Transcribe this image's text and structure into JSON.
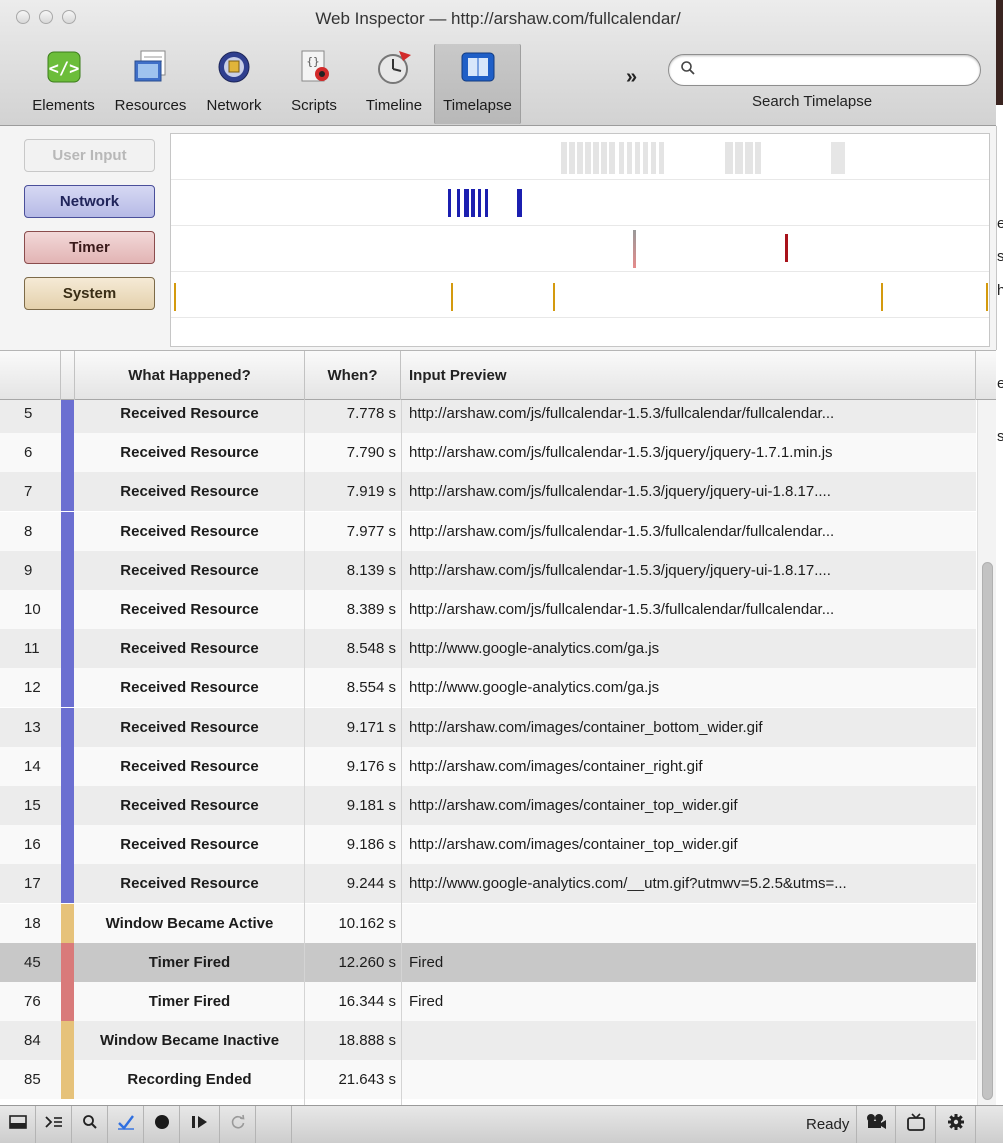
{
  "window": {
    "title": "Web Inspector — http://arshaw.com/fullcalendar/"
  },
  "toolbar": {
    "items": [
      {
        "label": "Elements"
      },
      {
        "label": "Resources"
      },
      {
        "label": "Network"
      },
      {
        "label": "Scripts"
      },
      {
        "label": "Timeline"
      },
      {
        "label": "Timelapse",
        "active": true
      }
    ],
    "overflow_label": "»",
    "search": {
      "value": "",
      "label": "Search Timelapse"
    }
  },
  "overview": {
    "categories": [
      {
        "label": "User Input",
        "enabled": false
      },
      {
        "label": "Network"
      },
      {
        "label": "Timer"
      },
      {
        "label": "System"
      }
    ],
    "colors": {
      "network": "#1b1fb0",
      "timer": "#a8121a",
      "system": "#d49a0e",
      "user": "#e2e2e2"
    }
  },
  "side_chars": [
    "e",
    "s",
    "h",
    "e",
    "s"
  ],
  "table": {
    "columns": [
      "What Happened?",
      "When?",
      "Input Preview"
    ],
    "rows": [
      {
        "num": "5",
        "kind": "network",
        "what": "Received Resource",
        "when": "7.778 s",
        "preview": "http://arshaw.com/js/fullcalendar-1.5.3/fullcalendar/fullcalendar..."
      },
      {
        "num": "6",
        "kind": "network",
        "what": "Received Resource",
        "when": "7.790 s",
        "preview": "http://arshaw.com/js/fullcalendar-1.5.3/jquery/jquery-1.7.1.min.js"
      },
      {
        "num": "7",
        "kind": "network",
        "what": "Received Resource",
        "when": "7.919 s",
        "preview": "http://arshaw.com/js/fullcalendar-1.5.3/jquery/jquery-ui-1.8.17...."
      },
      {
        "num": "8",
        "kind": "network",
        "what": "Received Resource",
        "when": "7.977 s",
        "preview": "http://arshaw.com/js/fullcalendar-1.5.3/fullcalendar/fullcalendar..."
      },
      {
        "num": "9",
        "kind": "network",
        "what": "Received Resource",
        "when": "8.139 s",
        "preview": "http://arshaw.com/js/fullcalendar-1.5.3/jquery/jquery-ui-1.8.17...."
      },
      {
        "num": "10",
        "kind": "network",
        "what": "Received Resource",
        "when": "8.389 s",
        "preview": "http://arshaw.com/js/fullcalendar-1.5.3/fullcalendar/fullcalendar..."
      },
      {
        "num": "11",
        "kind": "network",
        "what": "Received Resource",
        "when": "8.548 s",
        "preview": "http://www.google-analytics.com/ga.js"
      },
      {
        "num": "12",
        "kind": "network",
        "what": "Received Resource",
        "when": "8.554 s",
        "preview": "http://www.google-analytics.com/ga.js"
      },
      {
        "num": "13",
        "kind": "network",
        "what": "Received Resource",
        "when": "9.171 s",
        "preview": "http://arshaw.com/images/container_bottom_wider.gif"
      },
      {
        "num": "14",
        "kind": "network",
        "what": "Received Resource",
        "when": "9.176 s",
        "preview": "http://arshaw.com/images/container_right.gif"
      },
      {
        "num": "15",
        "kind": "network",
        "what": "Received Resource",
        "when": "9.181 s",
        "preview": "http://arshaw.com/images/container_top_wider.gif"
      },
      {
        "num": "16",
        "kind": "network",
        "what": "Received Resource",
        "when": "9.186 s",
        "preview": "http://arshaw.com/images/container_top_wider.gif"
      },
      {
        "num": "17",
        "kind": "network",
        "what": "Received Resource",
        "when": "9.244 s",
        "preview": "http://www.google-analytics.com/__utm.gif?utmwv=5.2.5&utms=..."
      },
      {
        "num": "18",
        "kind": "system",
        "what": "Window Became Active",
        "when": "10.162 s",
        "preview": ""
      },
      {
        "num": "45",
        "kind": "timer",
        "what": "Timer Fired",
        "when": "12.260 s",
        "preview": "Fired",
        "selected": true
      },
      {
        "num": "76",
        "kind": "timer",
        "what": "Timer Fired",
        "when": "16.344 s",
        "preview": "Fired"
      },
      {
        "num": "84",
        "kind": "system",
        "what": "Window Became Inactive",
        "when": "18.888 s",
        "preview": ""
      },
      {
        "num": "85",
        "kind": "system",
        "what": "Recording Ended",
        "when": "21.643 s",
        "preview": ""
      }
    ],
    "row_colors": {
      "network": "#6b6fd1",
      "timer": "#d97a7a",
      "system": "#e6c27a"
    }
  },
  "statusbar": {
    "ready": "Ready",
    "buttons": [
      {
        "name": "dock-icon"
      },
      {
        "name": "console-icon"
      },
      {
        "name": "search-icon"
      },
      {
        "name": "checkmark-icon"
      },
      {
        "name": "record-icon"
      },
      {
        "name": "play-icon"
      },
      {
        "name": "refresh-icon"
      }
    ]
  }
}
